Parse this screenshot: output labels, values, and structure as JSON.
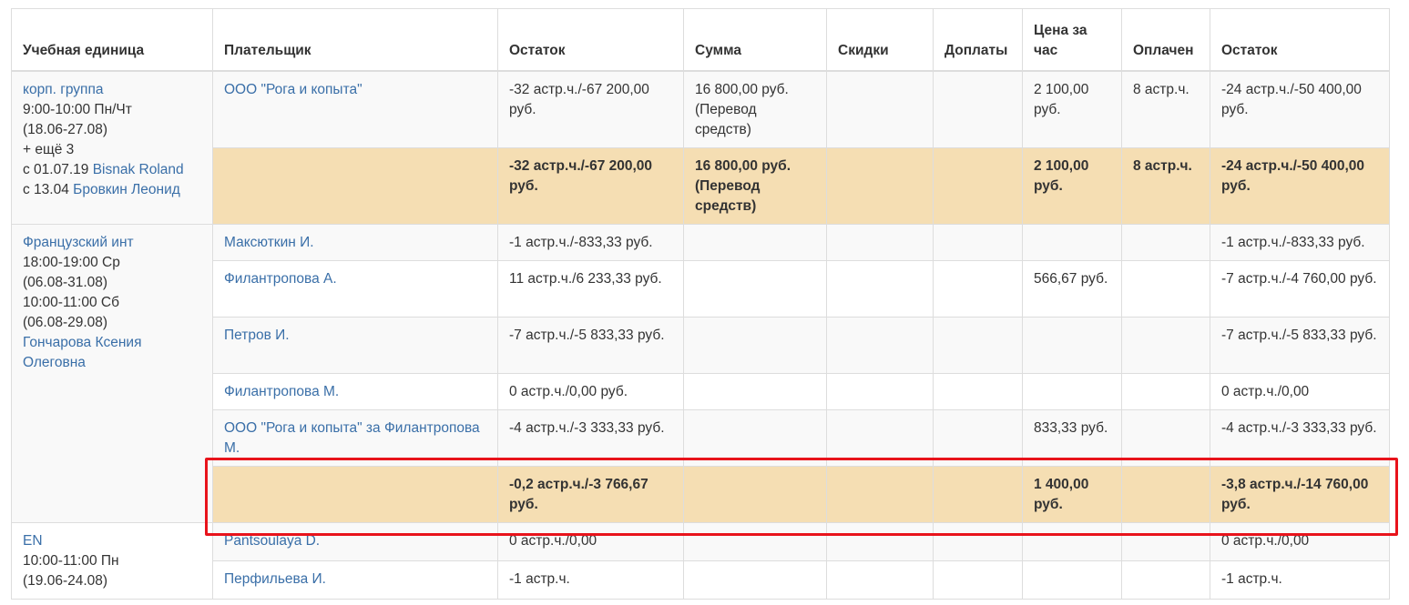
{
  "headers": {
    "unit": "Учебная единица",
    "payer": "Плательщик",
    "balance_start": "Остаток",
    "sum": "Сумма",
    "discounts": "Скидки",
    "surcharges": "Доплаты",
    "price_per_hour": "Цена за час",
    "paid": "Оплачен",
    "balance_end": "Остаток"
  },
  "groups": [
    {
      "unit": {
        "name": "корп. группа",
        "schedule": [
          "9:00-10:00 Пн/Чт",
          "(18.06-27.08)",
          "+ ещё 3"
        ],
        "teachers": [
          {
            "prefix": "с 01.07.19 ",
            "name": "Bisnak Roland"
          },
          {
            "prefix": "с 13.04 ",
            "name": "Бровкин Леонид"
          }
        ]
      },
      "rows": [
        {
          "payer": "ООО \"Рога и копыта\"",
          "balance_start": "-32 астр.ч./-67 200,00 руб.",
          "sum": "16 800,00 руб. (Перевод средств)",
          "discounts": "",
          "surcharges": "",
          "price": "2 100,00 руб.",
          "paid": "8 астр.ч.",
          "balance_end": "-24 астр.ч./-50 400,00 руб."
        }
      ],
      "total": {
        "balance_start": "-32 астр.ч./-67 200,00 руб.",
        "sum": "16 800,00 руб. (Перевод средств)",
        "discounts": "",
        "surcharges": "",
        "price": "2 100,00 руб.",
        "paid": "8 астр.ч.",
        "balance_end": "-24 астр.ч./-50 400,00 руб."
      }
    },
    {
      "unit": {
        "name": "Французский инт",
        "schedule": [
          "18:00-19:00 Ср",
          "(06.08-31.08)",
          "10:00-11:00 Сб",
          "(06.08-29.08)"
        ],
        "teacher": "Гончарова Ксения Олеговна"
      },
      "rows": [
        {
          "payer": "Максюткин И.",
          "balance_start": "-1 астр.ч./-833,33 руб.",
          "sum": "",
          "discounts": "",
          "surcharges": "",
          "price": "",
          "paid": "",
          "balance_end": "-1 астр.ч./-833,33 руб."
        },
        {
          "payer": "Филантропова А.",
          "balance_start": "11 астр.ч./6 233,33 руб.",
          "sum": "",
          "discounts": "",
          "surcharges": "",
          "price": "566,67 руб.",
          "paid": "",
          "balance_end": "-7 астр.ч./-4 760,00 руб."
        },
        {
          "payer": "Петров И.",
          "balance_start": "-7 астр.ч./-5 833,33 руб.",
          "sum": "",
          "discounts": "",
          "surcharges": "",
          "price": "",
          "paid": "",
          "balance_end": "-7 астр.ч./-5 833,33 руб."
        },
        {
          "payer": "Филантропова М.",
          "balance_start": "0 астр.ч./0,00 руб.",
          "sum": "",
          "discounts": "",
          "surcharges": "",
          "price": "",
          "paid": "",
          "balance_end": "0 астр.ч./0,00"
        },
        {
          "payer": "ООО \"Рога и копыта\" за Филантропова М.",
          "balance_start": "-4 астр.ч./-3 333,33 руб.",
          "sum": "",
          "discounts": "",
          "surcharges": "",
          "price": "833,33 руб.",
          "paid": "",
          "balance_end": "-4 астр.ч./-3 333,33 руб."
        }
      ],
      "total": {
        "balance_start": "-0,2 астр.ч./-3 766,67 руб.",
        "sum": "",
        "discounts": "",
        "surcharges": "",
        "price": "1 400,00 руб.",
        "paid": "",
        "balance_end": "-3,8 астр.ч./-14 760,00 руб."
      }
    },
    {
      "unit": {
        "name": "EN",
        "schedule": [
          "10:00-11:00 Пн",
          "(19.06-24.08)"
        ]
      },
      "rows": [
        {
          "payer": "Pantsoulaya D.",
          "balance_start": "0 астр.ч./0,00",
          "sum": "",
          "discounts": "",
          "surcharges": "",
          "price": "",
          "paid": "",
          "balance_end": "0 астр.ч./0,00"
        },
        {
          "payer": "Перфильева И.",
          "balance_start": "-1 астр.ч.",
          "sum": "",
          "discounts": "",
          "surcharges": "",
          "price": "",
          "paid": "",
          "balance_end": "-1 астр.ч."
        }
      ]
    }
  ],
  "colors": {
    "link": "#3a6fa8",
    "total_row_bg": "#f5deb3",
    "highlight_border": "#e8131b",
    "stripe_bg": "#f9f9f9",
    "border": "#dddddd"
  }
}
